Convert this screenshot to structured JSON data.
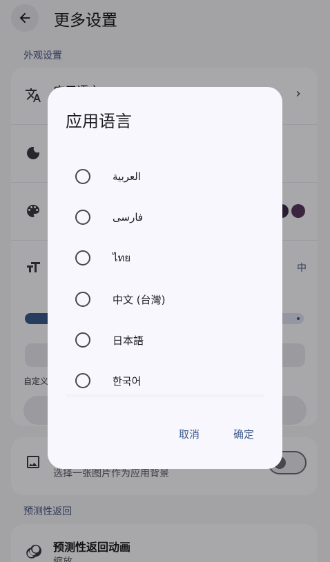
{
  "header": {
    "title": "更多设置"
  },
  "sections": {
    "appearance": "外观设置",
    "predictive_back": "预测性返回"
  },
  "settings": {
    "language": {
      "title": "应用语言"
    },
    "font_size_value": "中",
    "custom_label": "自定义",
    "background": {
      "subtitle": "选择一张图片作为应用背景"
    },
    "predictive_anim": {
      "title": "预测性返回动画",
      "subtitle": "缩放"
    }
  },
  "colors": {
    "accent": "#3c5a8d",
    "swatch_1": "#3b2f4a",
    "swatch_2": "#5a3a5e"
  },
  "dialog": {
    "title": "应用语言",
    "options": [
      {
        "label": "العربية",
        "selected": false
      },
      {
        "label": "فارسی",
        "selected": false
      },
      {
        "label": "ไทย",
        "selected": false
      },
      {
        "label": "中文 (台灣)",
        "selected": false
      },
      {
        "label": "日本語",
        "selected": false
      },
      {
        "label": "한국어",
        "selected": false
      }
    ],
    "cancel": "取消",
    "confirm": "确定"
  }
}
